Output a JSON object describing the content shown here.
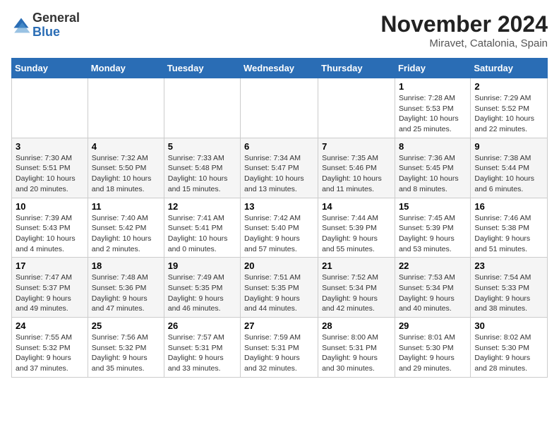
{
  "header": {
    "logo_general": "General",
    "logo_blue": "Blue",
    "month": "November 2024",
    "location": "Miravet, Catalonia, Spain"
  },
  "weekdays": [
    "Sunday",
    "Monday",
    "Tuesday",
    "Wednesday",
    "Thursday",
    "Friday",
    "Saturday"
  ],
  "weeks": [
    [
      {
        "day": "",
        "info": ""
      },
      {
        "day": "",
        "info": ""
      },
      {
        "day": "",
        "info": ""
      },
      {
        "day": "",
        "info": ""
      },
      {
        "day": "",
        "info": ""
      },
      {
        "day": "1",
        "info": "Sunrise: 7:28 AM\nSunset: 5:53 PM\nDaylight: 10 hours and 25 minutes."
      },
      {
        "day": "2",
        "info": "Sunrise: 7:29 AM\nSunset: 5:52 PM\nDaylight: 10 hours and 22 minutes."
      }
    ],
    [
      {
        "day": "3",
        "info": "Sunrise: 7:30 AM\nSunset: 5:51 PM\nDaylight: 10 hours and 20 minutes."
      },
      {
        "day": "4",
        "info": "Sunrise: 7:32 AM\nSunset: 5:50 PM\nDaylight: 10 hours and 18 minutes."
      },
      {
        "day": "5",
        "info": "Sunrise: 7:33 AM\nSunset: 5:48 PM\nDaylight: 10 hours and 15 minutes."
      },
      {
        "day": "6",
        "info": "Sunrise: 7:34 AM\nSunset: 5:47 PM\nDaylight: 10 hours and 13 minutes."
      },
      {
        "day": "7",
        "info": "Sunrise: 7:35 AM\nSunset: 5:46 PM\nDaylight: 10 hours and 11 minutes."
      },
      {
        "day": "8",
        "info": "Sunrise: 7:36 AM\nSunset: 5:45 PM\nDaylight: 10 hours and 8 minutes."
      },
      {
        "day": "9",
        "info": "Sunrise: 7:38 AM\nSunset: 5:44 PM\nDaylight: 10 hours and 6 minutes."
      }
    ],
    [
      {
        "day": "10",
        "info": "Sunrise: 7:39 AM\nSunset: 5:43 PM\nDaylight: 10 hours and 4 minutes."
      },
      {
        "day": "11",
        "info": "Sunrise: 7:40 AM\nSunset: 5:42 PM\nDaylight: 10 hours and 2 minutes."
      },
      {
        "day": "12",
        "info": "Sunrise: 7:41 AM\nSunset: 5:41 PM\nDaylight: 10 hours and 0 minutes."
      },
      {
        "day": "13",
        "info": "Sunrise: 7:42 AM\nSunset: 5:40 PM\nDaylight: 9 hours and 57 minutes."
      },
      {
        "day": "14",
        "info": "Sunrise: 7:44 AM\nSunset: 5:39 PM\nDaylight: 9 hours and 55 minutes."
      },
      {
        "day": "15",
        "info": "Sunrise: 7:45 AM\nSunset: 5:39 PM\nDaylight: 9 hours and 53 minutes."
      },
      {
        "day": "16",
        "info": "Sunrise: 7:46 AM\nSunset: 5:38 PM\nDaylight: 9 hours and 51 minutes."
      }
    ],
    [
      {
        "day": "17",
        "info": "Sunrise: 7:47 AM\nSunset: 5:37 PM\nDaylight: 9 hours and 49 minutes."
      },
      {
        "day": "18",
        "info": "Sunrise: 7:48 AM\nSunset: 5:36 PM\nDaylight: 9 hours and 47 minutes."
      },
      {
        "day": "19",
        "info": "Sunrise: 7:49 AM\nSunset: 5:35 PM\nDaylight: 9 hours and 46 minutes."
      },
      {
        "day": "20",
        "info": "Sunrise: 7:51 AM\nSunset: 5:35 PM\nDaylight: 9 hours and 44 minutes."
      },
      {
        "day": "21",
        "info": "Sunrise: 7:52 AM\nSunset: 5:34 PM\nDaylight: 9 hours and 42 minutes."
      },
      {
        "day": "22",
        "info": "Sunrise: 7:53 AM\nSunset: 5:34 PM\nDaylight: 9 hours and 40 minutes."
      },
      {
        "day": "23",
        "info": "Sunrise: 7:54 AM\nSunset: 5:33 PM\nDaylight: 9 hours and 38 minutes."
      }
    ],
    [
      {
        "day": "24",
        "info": "Sunrise: 7:55 AM\nSunset: 5:32 PM\nDaylight: 9 hours and 37 minutes."
      },
      {
        "day": "25",
        "info": "Sunrise: 7:56 AM\nSunset: 5:32 PM\nDaylight: 9 hours and 35 minutes."
      },
      {
        "day": "26",
        "info": "Sunrise: 7:57 AM\nSunset: 5:31 PM\nDaylight: 9 hours and 33 minutes."
      },
      {
        "day": "27",
        "info": "Sunrise: 7:59 AM\nSunset: 5:31 PM\nDaylight: 9 hours and 32 minutes."
      },
      {
        "day": "28",
        "info": "Sunrise: 8:00 AM\nSunset: 5:31 PM\nDaylight: 9 hours and 30 minutes."
      },
      {
        "day": "29",
        "info": "Sunrise: 8:01 AM\nSunset: 5:30 PM\nDaylight: 9 hours and 29 minutes."
      },
      {
        "day": "30",
        "info": "Sunrise: 8:02 AM\nSunset: 5:30 PM\nDaylight: 9 hours and 28 minutes."
      }
    ]
  ]
}
